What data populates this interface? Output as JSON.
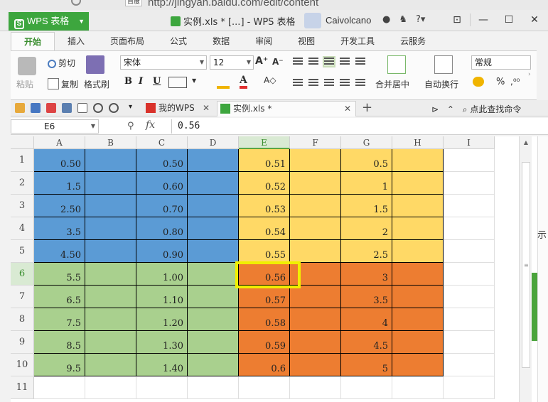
{
  "browser": {
    "badge": "百度",
    "url_fragment": "http://jingyan.baidu.com/edit/content"
  },
  "app": {
    "menu_button": "WPS 表格",
    "window_title": "实例.xls * [...] - WPS 表格",
    "username": "Caivolcano"
  },
  "ribbon_tabs": [
    "开始",
    "插入",
    "页面布局",
    "公式",
    "数据",
    "审阅",
    "视图",
    "开发工具",
    "云服务"
  ],
  "ribbon": {
    "paste": "粘贴",
    "cut": "剪切",
    "copy": "复制",
    "format_painter": "格式刷",
    "font_name": "宋体",
    "font_size": "12",
    "bold": "B",
    "italic": "I",
    "underline": "U",
    "merge_center": "合并居中",
    "wrap_text": "自动换行",
    "number_format": "常规",
    "percent": "%"
  },
  "doc_tabs": [
    {
      "label": "我的WPS",
      "active": false
    },
    {
      "label": "实例.xls *",
      "active": true
    }
  ],
  "quick_search": "点此查找命令",
  "formula_bar": {
    "cell_ref": "E6",
    "fx": "fx",
    "value": "0.56"
  },
  "columns": [
    "A",
    "B",
    "C",
    "D",
    "E",
    "F",
    "G",
    "H",
    "I"
  ],
  "selected_column": "E",
  "selected_row": "6",
  "rows": [
    {
      "n": "1",
      "A": "0.50",
      "C": "0.50",
      "E": "0.51",
      "G": "0.5"
    },
    {
      "n": "2",
      "A": "1.5",
      "C": "0.60",
      "E": "0.52",
      "G": "1"
    },
    {
      "n": "3",
      "A": "2.50",
      "C": "0.70",
      "E": "0.53",
      "G": "1.5"
    },
    {
      "n": "4",
      "A": "3.5",
      "C": "0.80",
      "E": "0.54",
      "G": "2"
    },
    {
      "n": "5",
      "A": "4.50",
      "C": "0.90",
      "E": "0.55",
      "G": "2.5"
    },
    {
      "n": "6",
      "A": "5.5",
      "C": "1.00",
      "E": "0.56",
      "G": "3"
    },
    {
      "n": "7",
      "A": "6.5",
      "C": "1.10",
      "E": "0.57",
      "G": "3.5"
    },
    {
      "n": "8",
      "A": "7.5",
      "C": "1.20",
      "E": "0.58",
      "G": "4"
    },
    {
      "n": "9",
      "A": "8.5",
      "C": "1.30",
      "E": "0.59",
      "G": "4.5"
    },
    {
      "n": "10",
      "A": "9.5",
      "C": "1.40",
      "E": "0.6",
      "G": "5"
    },
    {
      "n": "11"
    }
  ],
  "colors": {
    "blue": "#5b9bd5",
    "yellow": "#ffd966",
    "green": "#a9d08e",
    "orange": "#ed7d31",
    "wps_green": "#3da63e",
    "selection": "#f1ef00"
  },
  "side_panel_char": "示"
}
